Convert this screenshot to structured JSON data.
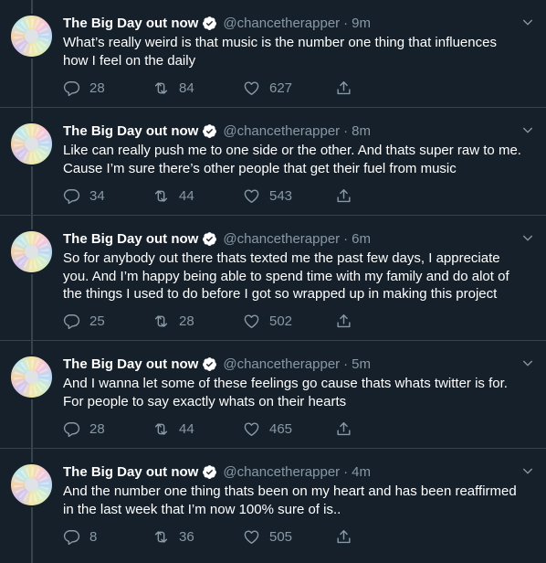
{
  "author": {
    "display_name": "The Big Day out now",
    "handle": "@chancetherapper"
  },
  "tweets": [
    {
      "time": "9m",
      "lines": [
        "What’s really weird is that music is the number one thing that influences",
        "how I feel on the daily"
      ],
      "replies": "28",
      "retweets": "84",
      "likes": "627"
    },
    {
      "time": "8m",
      "lines": [
        "Like can really push me to one side or the other. And thats super raw to me.",
        "Cause I’m sure there’s other people that get their fuel from music"
      ],
      "replies": "34",
      "retweets": "44",
      "likes": "543"
    },
    {
      "time": "6m",
      "lines": [
        "So for anybody out there thats texted me the past few days, I appreciate",
        "you. And I’m happy being able to spend time with my family and do alot of",
        "the things I used to do before I got so wrapped up in making this project"
      ],
      "replies": "25",
      "retweets": "28",
      "likes": "502"
    },
    {
      "time": "5m",
      "lines": [
        "And I wanna let some of these feelings go cause thats whats twitter is for.",
        "For people to say exactly whats on their hearts"
      ],
      "replies": "28",
      "retweets": "44",
      "likes": "465"
    },
    {
      "time": "4m",
      "lines": [
        "And the number one thing thats been on my heart and has been reaffirmed",
        "in the last week that I’m now 100% sure of is.."
      ],
      "replies": "8",
      "retweets": "36",
      "likes": "505"
    }
  ],
  "separator": "·",
  "icons": [
    "verified-icon",
    "chevron-down-icon",
    "reply-icon",
    "retweet-icon",
    "like-icon",
    "share-icon"
  ],
  "colors": {
    "background": "#15202b",
    "secondary_text": "#8899a6",
    "divider": "#38444d",
    "verified": "#ffffff"
  }
}
